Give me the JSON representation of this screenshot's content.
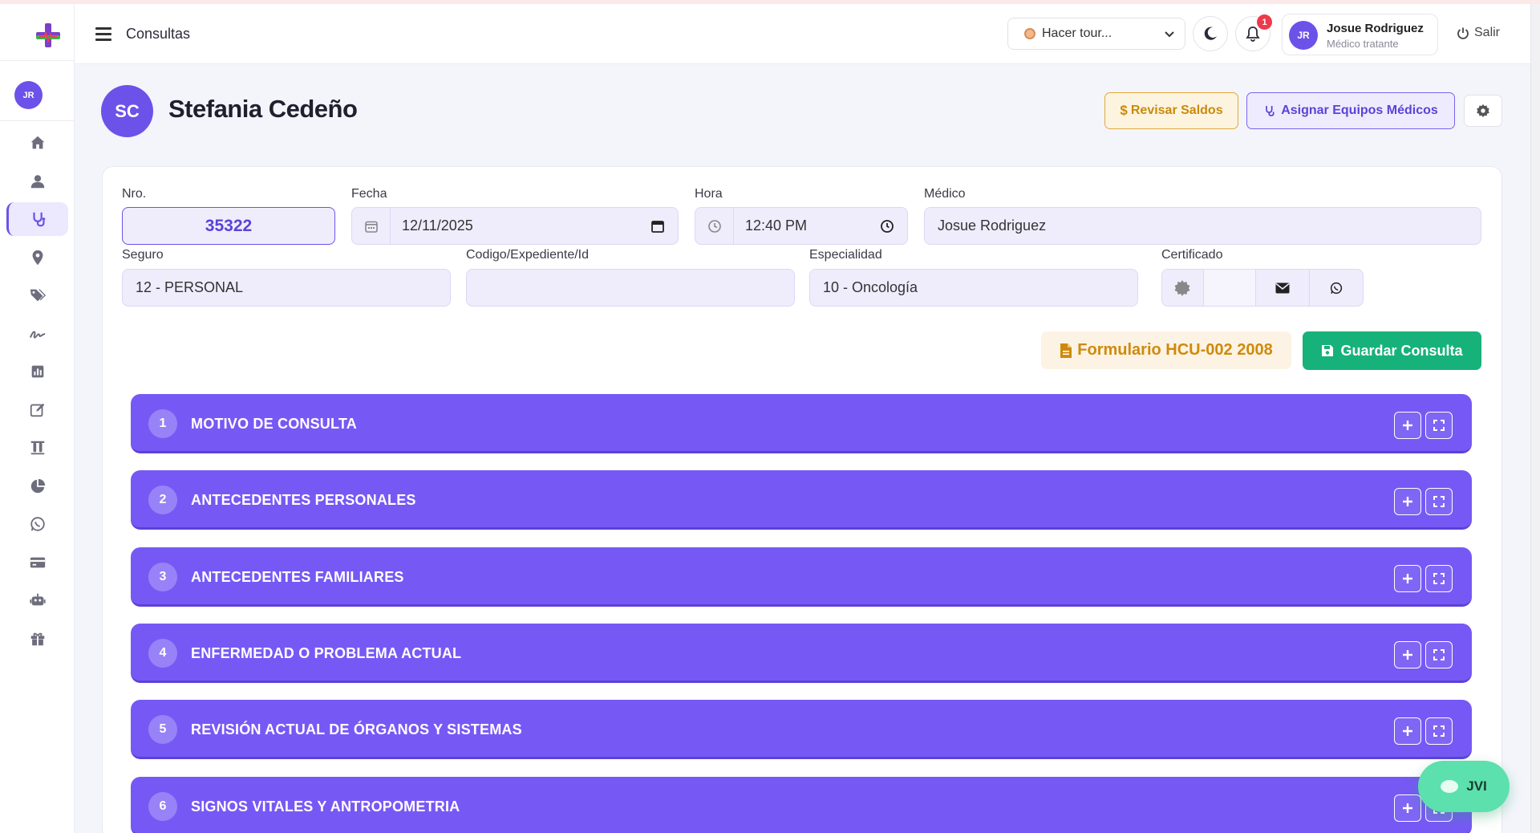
{
  "header": {
    "title": "Consultas",
    "tour_label": "Hacer tour...",
    "notification_count": "1",
    "user": {
      "initials": "JR",
      "name": "Josue Rodriguez",
      "role": "Médico tratante"
    },
    "logout_label": "Salir"
  },
  "sidebar": {
    "avatar_initials": "JR",
    "items": [
      {
        "icon": "home-icon"
      },
      {
        "icon": "user-icon"
      },
      {
        "icon": "stethoscope-icon",
        "active": true
      },
      {
        "icon": "location-pin-icon"
      },
      {
        "icon": "tags-icon"
      },
      {
        "icon": "signature-icon"
      },
      {
        "icon": "bar-chart-icon"
      },
      {
        "icon": "edit-icon"
      },
      {
        "icon": "lab-tubes-icon"
      },
      {
        "icon": "pie-chart-icon"
      },
      {
        "icon": "whatsapp-icon"
      },
      {
        "icon": "credit-card-icon"
      },
      {
        "icon": "robot-icon"
      },
      {
        "icon": "gift-icon"
      }
    ]
  },
  "patient": {
    "initials": "SC",
    "name": "Stefania Cedeño"
  },
  "actions": {
    "revisar_saldos": "Revisar Saldos",
    "asignar_equipos": "Asignar Equipos Médicos"
  },
  "form": {
    "nro_label": "Nro.",
    "nro_value": "35322",
    "fecha_label": "Fecha",
    "fecha_value": "12/11/2025",
    "hora_label": "Hora",
    "hora_value": "12:40 PM",
    "medico_label": "Médico",
    "medico_value": "Josue Rodriguez",
    "seguro_label": "Seguro",
    "seguro_value": "12 - PERSONAL",
    "codigo_label": "Codigo/Expediente/Id",
    "codigo_value": "",
    "especialidad_label": "Especialidad",
    "especialidad_value": "10 - Oncología",
    "certificado_label": "Certificado",
    "formulario_label": "Formulario HCU-002 2008",
    "guardar_label": "Guardar Consulta"
  },
  "sections": [
    {
      "num": "1",
      "title": "MOTIVO DE CONSULTA"
    },
    {
      "num": "2",
      "title": "ANTECEDENTES PERSONALES"
    },
    {
      "num": "3",
      "title": "ANTECEDENTES FAMILIARES"
    },
    {
      "num": "4",
      "title": "ENFERMEDAD O PROBLEMA ACTUAL"
    },
    {
      "num": "5",
      "title": "REVISIÓN ACTUAL DE ÓRGANOS Y SISTEMAS"
    },
    {
      "num": "6",
      "title": "SIGNOS VITALES Y ANTROPOMETRIA"
    }
  ],
  "chat": {
    "label": "JVI"
  },
  "colors": {
    "primary": "#6c52e9",
    "section": "#7659f5",
    "success": "#17b27a",
    "warning": "#e0a93a"
  }
}
